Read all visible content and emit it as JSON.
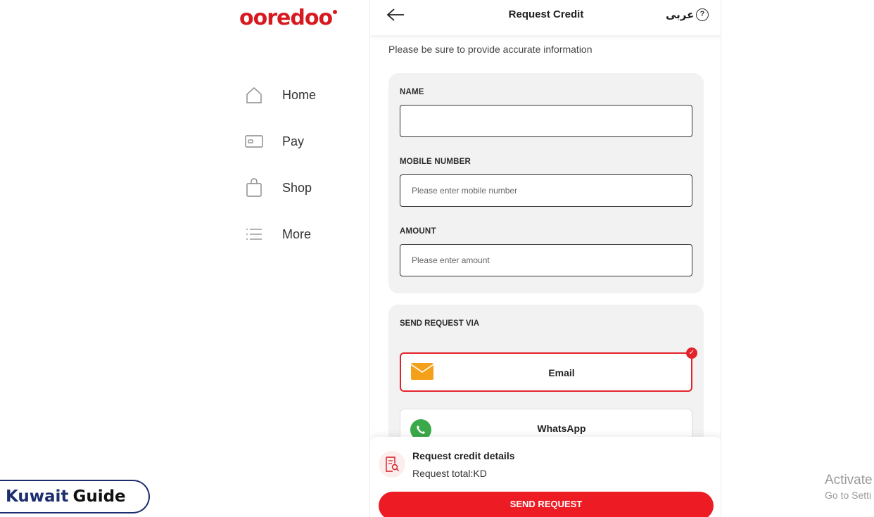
{
  "brand": {
    "logo_text": "ooredoo",
    "color": "#d71920"
  },
  "nav": {
    "items": [
      {
        "label": "Home",
        "icon": "home-icon"
      },
      {
        "label": "Pay",
        "icon": "card-icon"
      },
      {
        "label": "Shop",
        "icon": "bag-icon"
      },
      {
        "label": "More",
        "icon": "list-icon"
      }
    ]
  },
  "header": {
    "title": "Request Credit",
    "lang_label": "عربى",
    "help_glyph": "?"
  },
  "intro": "Please be sure to provide accurate information",
  "form": {
    "name_label": "NAME",
    "name_value": "",
    "mobile_label": "MOBILE NUMBER",
    "mobile_placeholder": "Please enter mobile number",
    "amount_label": "AMOUNT",
    "amount_placeholder": "Please enter amount"
  },
  "send_via": {
    "label": "SEND REQUEST VIA",
    "options": [
      {
        "label": "Email",
        "selected": true,
        "icon": "envelope-icon"
      },
      {
        "label": "WhatsApp",
        "selected": false,
        "icon": "whatsapp-icon"
      }
    ],
    "check_glyph": "✓"
  },
  "summary": {
    "title": "Request credit details",
    "total": "Request total:KD",
    "button_label": "SEND REQUEST"
  },
  "watermarks": {
    "kuwait": "Kuwait",
    "guide": "Guide",
    "activate_line1": "Activate",
    "activate_line2": "Go to Setti"
  },
  "colors": {
    "accent": "#ed1c24",
    "email_icon": "#f5a01a",
    "whatsapp_icon": "#3aa94a"
  }
}
